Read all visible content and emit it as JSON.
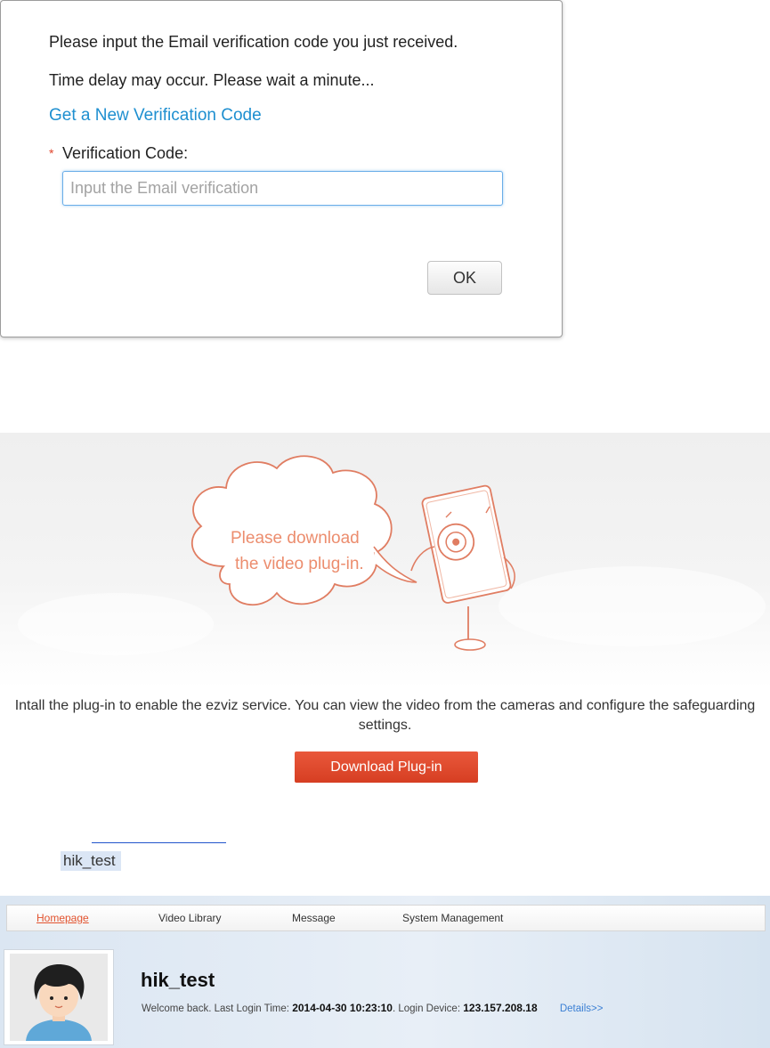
{
  "dialog": {
    "line1": "Please input the Email verification code you just received.",
    "line2": "Time delay may occur. Please wait a minute...",
    "new_code_link": "Get a New Verification Code",
    "required_mark": "*",
    "code_label": "Verification Code:",
    "code_placeholder": "Input the Email verification",
    "ok_label": "OK"
  },
  "plugin": {
    "cloud_line1": "Please download",
    "cloud_line2": "the video plug-in.",
    "description": "Intall the plug-in to enable the ezviz service. You can view the video from the cameras and configure the safeguarding settings.",
    "download_button": "Download Plug-in",
    "accent_color": "#e04a2d"
  },
  "selected_username": "hik_test",
  "home": {
    "nav": [
      {
        "label": "Homepage",
        "active": true
      },
      {
        "label": "Video Library",
        "active": false
      },
      {
        "label": "Message",
        "active": false
      },
      {
        "label": "System Management",
        "active": false
      }
    ],
    "username": "hik_test",
    "welcome_prefix": "Welcome back. Last Login Time:",
    "last_login_time": "2014-04-30 10:23:10",
    "device_prefix": ". Login Device:",
    "login_device": "123.157.208.18",
    "details_link": "Details>>"
  }
}
